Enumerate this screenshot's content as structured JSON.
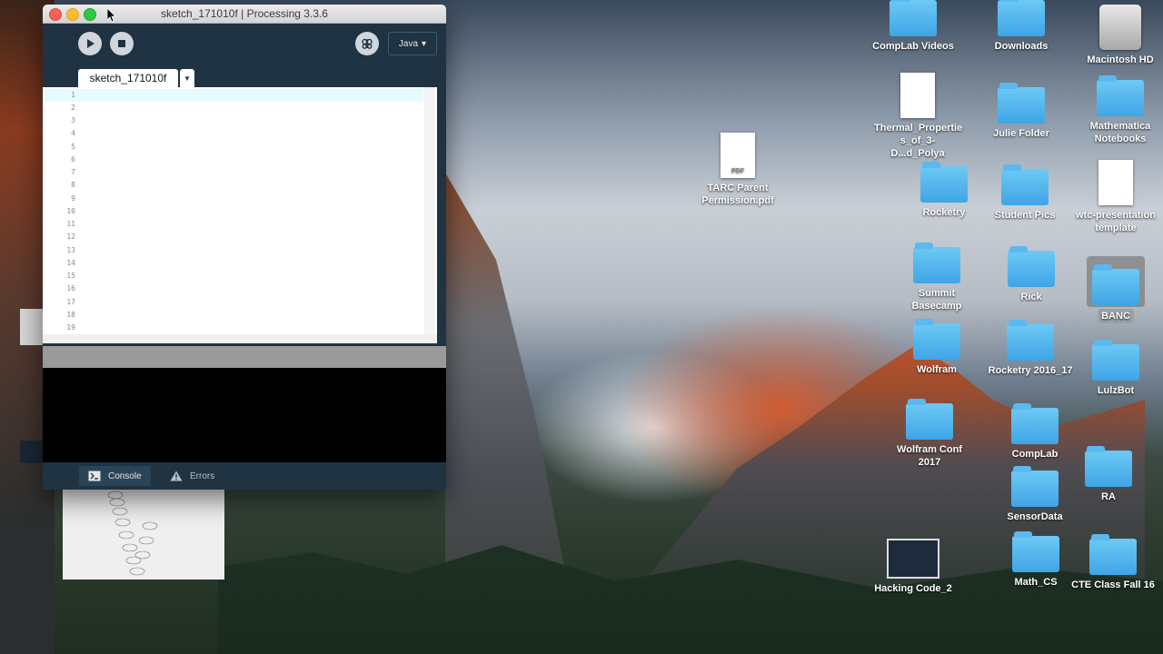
{
  "processing": {
    "window_title": "sketch_171010f | Processing 3.3.6",
    "mode": "Java",
    "tab_name": "sketch_171010f",
    "line_numbers": [
      "1",
      "2",
      "3",
      "4",
      "5",
      "6",
      "7",
      "8",
      "9",
      "10",
      "11",
      "12",
      "13",
      "14",
      "15",
      "16",
      "17",
      "18",
      "19"
    ],
    "footer": {
      "console_label": "Console",
      "errors_label": "Errors"
    }
  },
  "desktop": {
    "icons": {
      "complab_videos": "CompLab Videos",
      "downloads": "Downloads",
      "macintosh_hd": "Macintosh HD",
      "thermal": "Thermal_Propertie s_of_3-D...d_Polya",
      "julie_folder": "Julie Folder",
      "mathematica": "Mathematica Notebooks",
      "tarc": "TARC Parent Permission.pdf",
      "tarc_badge": "PDF",
      "rocketry": "Rocketry",
      "student_pics": "Student Pics",
      "wtc": "wtc-presentation template",
      "summit": "Summit Basecamp",
      "rick": "Rick",
      "banc": "BANC",
      "wolfram": "Wolfram",
      "rocketry2016": "Rocketry 2016_17",
      "lulzbot": "LulzBot",
      "wolfram_conf": "Wolfram Conf 2017",
      "complab": "CompLab",
      "ra": "RA",
      "sensordata": "SensorData",
      "hacking": "Hacking Code_2",
      "math_cs": "Math_CS",
      "cte": "CTE Class Fall 16"
    }
  }
}
